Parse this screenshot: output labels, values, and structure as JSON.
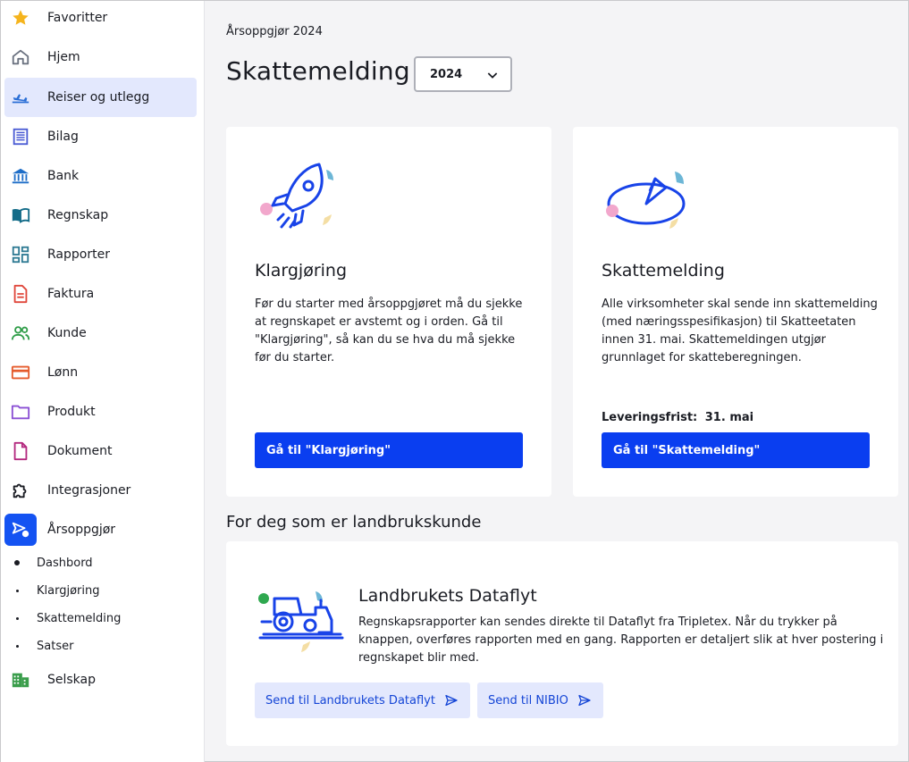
{
  "sidebar": {
    "items": [
      {
        "label": "Favoritter",
        "icon": "star-icon"
      },
      {
        "label": "Hjem",
        "icon": "home-icon"
      },
      {
        "label": "Reiser og utlegg",
        "icon": "airplane-icon"
      },
      {
        "label": "Bilag",
        "icon": "receipt-icon"
      },
      {
        "label": "Bank",
        "icon": "bank-icon"
      },
      {
        "label": "Regnskap",
        "icon": "book-icon"
      },
      {
        "label": "Rapporter",
        "icon": "dashboard-icon"
      },
      {
        "label": "Faktura",
        "icon": "invoice-icon"
      },
      {
        "label": "Kunde",
        "icon": "people-icon"
      },
      {
        "label": "Lønn",
        "icon": "credit-card-icon"
      },
      {
        "label": "Produkt",
        "icon": "folder-icon"
      },
      {
        "label": "Dokument",
        "icon": "document-icon"
      },
      {
        "label": "Integrasjoner",
        "icon": "puzzle-icon"
      },
      {
        "label": "Årsoppgjør",
        "icon": "annual-report-icon"
      },
      {
        "label": "Selskap",
        "icon": "building-icon"
      }
    ],
    "sub_items": [
      {
        "label": "Dashbord"
      },
      {
        "label": "Klargjøring"
      },
      {
        "label": "Skattemelding"
      },
      {
        "label": "Satser"
      }
    ]
  },
  "header": {
    "breadcrumb": "Årsoppgjør 2024",
    "title": "Skattemelding",
    "year_selected": "2024"
  },
  "cards": {
    "klargjoring": {
      "title": "Klargjøring",
      "text": "Før du starter med årsoppgjøret må du sjekke at regnskapet er avstemt og i orden. Gå til \"Klargjøring\", så kan du se hva du må sjekke før du starter.",
      "button": "Gå til \"Klargjøring\""
    },
    "skattemelding": {
      "title": "Skattemelding",
      "text": "Alle virksomheter skal sende inn skattemelding (med næringsspesifikasjon) til Skatteetaten innen 31. mai. Skattemeldingen utgjør grunnlaget for skatteberegningen.",
      "deadline_label": "Leveringsfrist:",
      "deadline_value": "31. mai",
      "button": "Gå til \"Skattemelding\""
    }
  },
  "landbruk": {
    "heading": "For deg som er landbrukskunde",
    "title": "Landbrukets Dataflyt",
    "text": "Regnskapsrapporter kan sendes direkte til Dataflyt fra Tripletex. Når du trykker på knappen, overføres rapporten med en gang. Rapporten er detaljert slik at hver postering i regnskapet blir med.",
    "button_dataflyt": "Send til Landbrukets Dataflyt",
    "button_nibio": "Send til NIBIO"
  },
  "colors": {
    "primary": "#0a3ef0",
    "active_nav": "#e3e8fd",
    "secondary_btn": "#e3e8fd"
  }
}
